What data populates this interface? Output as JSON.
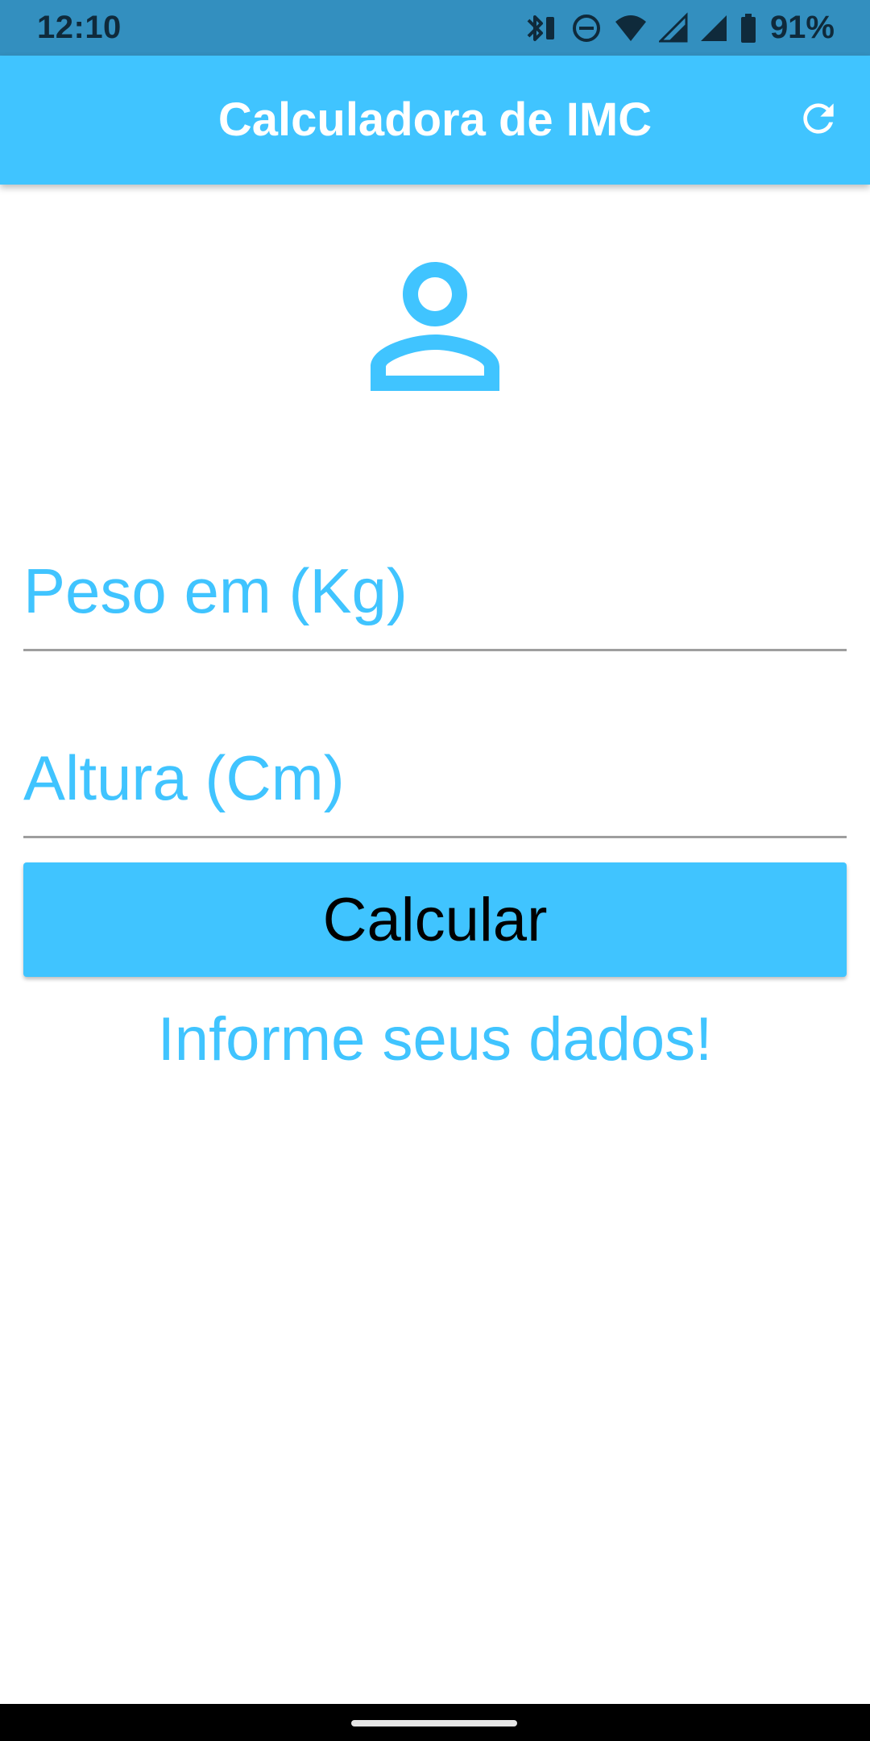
{
  "status_bar": {
    "time": "12:10",
    "battery": "91%",
    "icons": [
      "bluetooth-icon",
      "do-not-disturb-icon",
      "wifi-icon",
      "signal-icon",
      "signal-icon",
      "battery-icon"
    ]
  },
  "app_bar": {
    "title": "Calculadora de IMC",
    "action_icon": "refresh-icon"
  },
  "form": {
    "avatar_icon": "person-outline-icon",
    "weight_placeholder": "Peso em (Kg)",
    "weight_value": "",
    "height_placeholder": "Altura (Cm)",
    "height_value": "",
    "calculate_label": "Calcular",
    "info_text": "Informe seus dados!"
  },
  "colors": {
    "accent": "#40c4ff",
    "status_bar": "#338fbf",
    "background": "#ffffff",
    "divider": "#9e9e9e"
  }
}
